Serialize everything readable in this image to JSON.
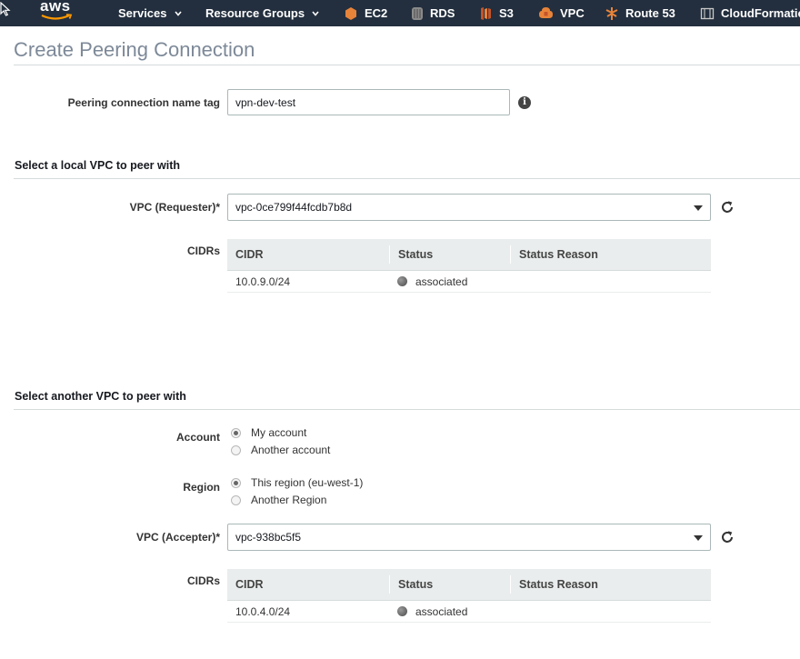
{
  "nav": {
    "logo": "aws",
    "items": [
      {
        "label": "Services"
      },
      {
        "label": "Resource Groups"
      },
      {
        "label": "EC2"
      },
      {
        "label": "RDS"
      },
      {
        "label": "S3"
      },
      {
        "label": "VPC"
      },
      {
        "label": "Route 53"
      },
      {
        "label": "CloudFormatio"
      }
    ]
  },
  "page": {
    "title": "Create Peering Connection"
  },
  "name_tag": {
    "label": "Peering connection name tag",
    "value": "vpn-dev-test"
  },
  "local": {
    "section_title": "Select a local VPC to peer with",
    "vpc_label": "VPC (Requester)*",
    "vpc_value": "vpc-0ce799f44fcdb7b8d",
    "cidrs_label": "CIDRs",
    "table": {
      "headers": [
        "CIDR",
        "Status",
        "Status Reason"
      ],
      "rows": [
        {
          "cidr": "10.0.9.0/24",
          "status": "associated",
          "reason": ""
        }
      ]
    }
  },
  "another": {
    "section_title": "Select another VPC to peer with",
    "account_label": "Account",
    "account_options": [
      {
        "label": "My account",
        "checked": true
      },
      {
        "label": "Another account",
        "checked": false
      }
    ],
    "region_label": "Region",
    "region_options": [
      {
        "label": "This region (eu-west-1)",
        "checked": true
      },
      {
        "label": "Another Region",
        "checked": false
      }
    ],
    "vpc_label": "VPC (Accepter)*",
    "vpc_value": "vpc-938bc5f5",
    "cidrs_label": "CIDRs",
    "table": {
      "headers": [
        "CIDR",
        "Status",
        "Status Reason"
      ],
      "rows": [
        {
          "cidr": "10.0.4.0/24",
          "status": "associated",
          "reason": ""
        }
      ]
    }
  },
  "colors": {
    "nav_bg": "#232f3e",
    "service_icon_orange": "#e8833a",
    "title_gray": "#7d8998"
  }
}
